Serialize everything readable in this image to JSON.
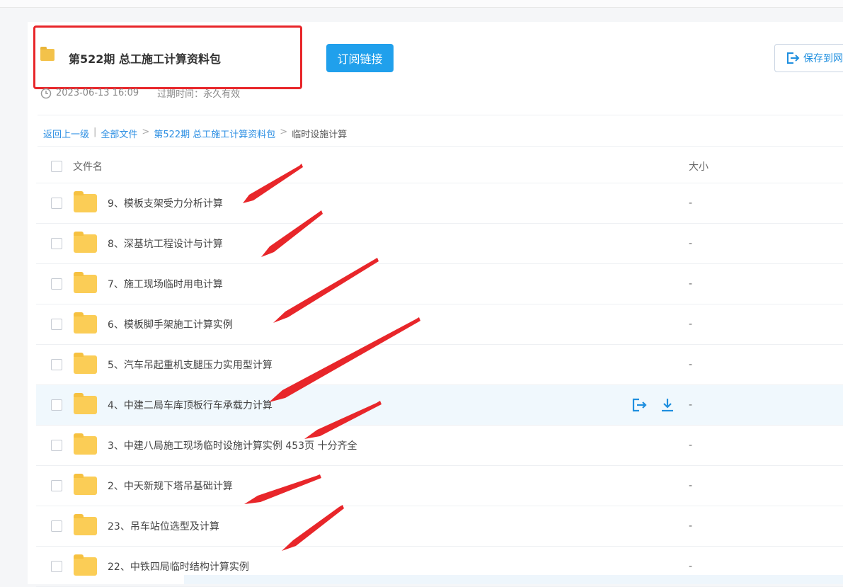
{
  "header": {
    "title": "第522期 总工施工计算资料包",
    "subscribe_label": "订阅链接",
    "save_label": "保存到网",
    "date": "2023-06-13 16:09",
    "expire": "过期时间：永久有效"
  },
  "breadcrumb": {
    "back": "返回上一级",
    "sep1": "|",
    "all": "全部文件",
    "arrow1": ">",
    "parent": "第522期 总工施工计算资料包",
    "arrow2": ">",
    "current": "临时设施计算"
  },
  "table": {
    "col_name": "文件名",
    "col_size": "大小",
    "rows": [
      {
        "name": "9、模板支架受力分析计算",
        "size": "-"
      },
      {
        "name": "8、深基坑工程设计与计算",
        "size": "-"
      },
      {
        "name": "7、施工现场临时用电计算",
        "size": "-"
      },
      {
        "name": "6、模板脚手架施工计算实例",
        "size": "-"
      },
      {
        "name": "5、汽车吊起重机支腿压力实用型计算",
        "size": "-"
      },
      {
        "name": "4、中建二局车库顶板行车承载力计算",
        "size": "-"
      },
      {
        "name": "3、中建八局施工现场临时设施计算实例 453页 十分齐全",
        "size": "-"
      },
      {
        "name": "2、中天新规下塔吊基础计算",
        "size": "-"
      },
      {
        "name": "23、吊车站位选型及计算",
        "size": "-"
      },
      {
        "name": "22、中铁四局临时结构计算实例",
        "size": "-"
      }
    ]
  },
  "colors": {
    "accent": "#20a0ec",
    "annotation": "#e8262a",
    "folder": "#fbcd56"
  }
}
